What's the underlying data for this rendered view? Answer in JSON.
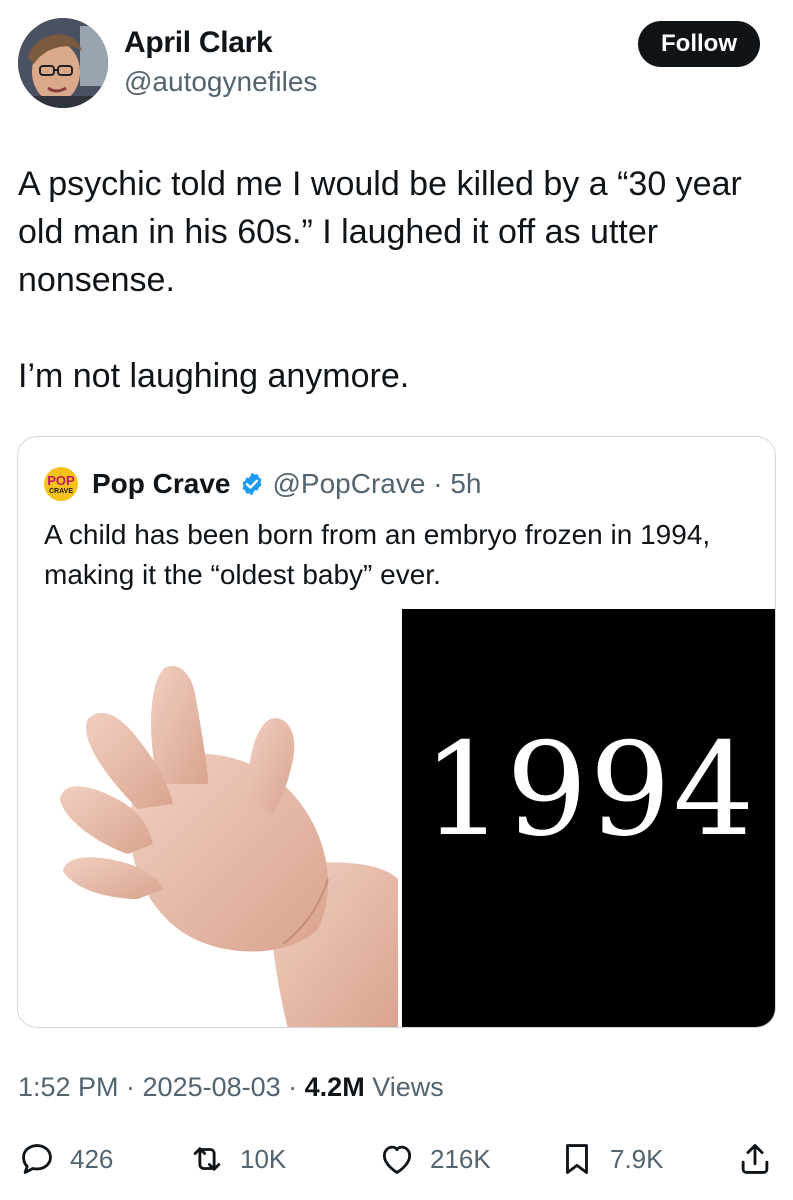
{
  "author": {
    "name": "April Clark",
    "handle": "@autogynefiles",
    "follow_label": "Follow"
  },
  "tweet": {
    "paragraphs": [
      "A psychic told me I would be killed by a “30 year old man in his 60s.” I laughed it off as utter nonsense.",
      "I’m not laughing anymore."
    ]
  },
  "quote": {
    "logo_top": "POP",
    "logo_bottom": "CRAVE",
    "name": "Pop Crave",
    "handle": "@PopCrave · 5h",
    "text": "A child has been born from an embryo frozen in 1994, making it the “oldest baby” ever.",
    "image_year": "1994"
  },
  "meta": {
    "time_date": "1:52 PM · 2025-08-03 · ",
    "views_count": "4.2M",
    "views_label": " Views"
  },
  "actions": {
    "replies": "426",
    "reposts": "10K",
    "likes": "216K",
    "bookmarks": "7.9K"
  },
  "colors": {
    "text": "#0f1419",
    "secondary": "#536471",
    "verified": "#1d9bf0",
    "border": "#cfd9de",
    "pop_crave_yellow": "#f5c21a"
  },
  "icons": [
    "reply-icon",
    "repost-icon",
    "like-icon",
    "bookmark-icon",
    "share-icon",
    "verified-badge-icon"
  ]
}
